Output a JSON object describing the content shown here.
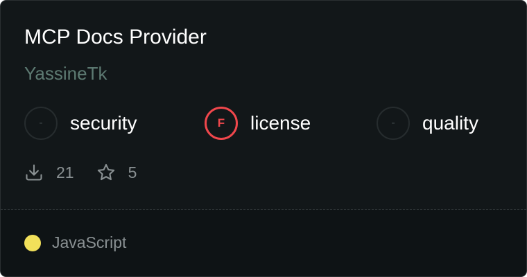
{
  "card": {
    "title": "MCP Docs Provider",
    "author": "YassineTk"
  },
  "scores": [
    {
      "label": "security",
      "grade": "-"
    },
    {
      "label": "license",
      "grade": "F"
    },
    {
      "label": "quality",
      "grade": "-"
    }
  ],
  "stats": {
    "downloads": "21",
    "downloads_icon": "download-icon",
    "stars": "5",
    "stars_icon": "star-icon"
  },
  "footer": {
    "language": "JavaScript",
    "language_color": "#f1e05a"
  },
  "colors": {
    "card_background": "#121719",
    "footer_background": "#0e1315",
    "fail_red": "#f0474c",
    "author_green": "#5d7a72"
  }
}
